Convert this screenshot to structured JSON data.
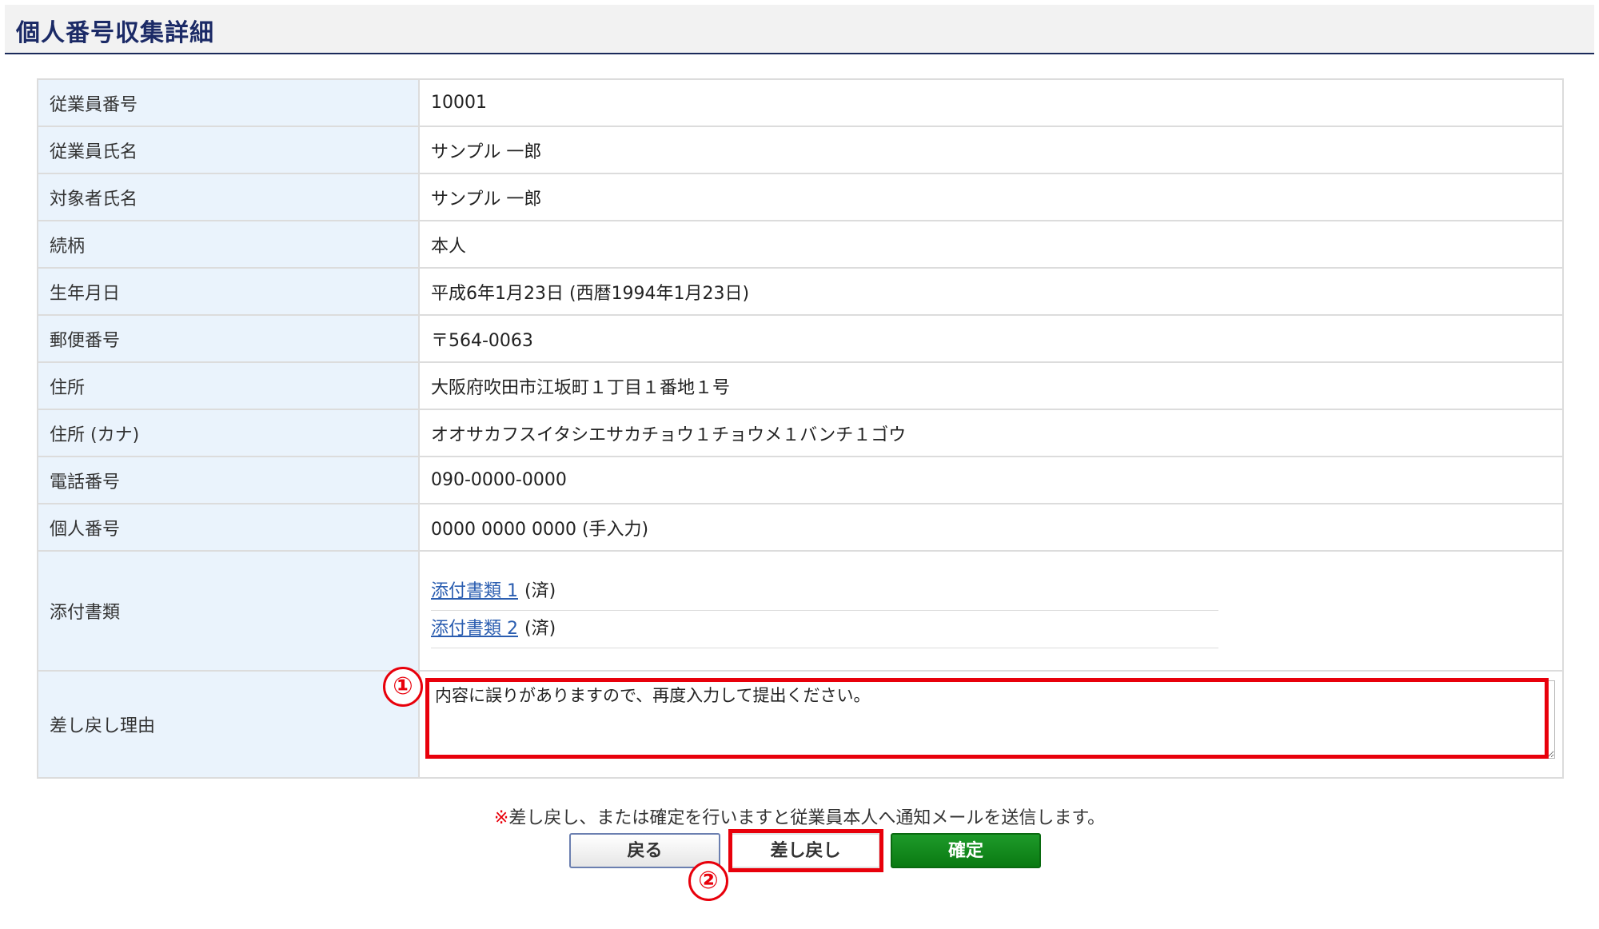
{
  "header": {
    "title": "個人番号収集詳細"
  },
  "details": {
    "rows": [
      {
        "label": "従業員番号",
        "value": "10001"
      },
      {
        "label": "従業員氏名",
        "value": "サンプル 一郎"
      },
      {
        "label": "対象者氏名",
        "value": "サンプル 一郎"
      },
      {
        "label": "続柄",
        "value": "本人"
      },
      {
        "label": "生年月日",
        "value": "平成6年1月23日 (西暦1994年1月23日)"
      },
      {
        "label": "郵便番号",
        "value": "〒564-0063"
      },
      {
        "label": "住所",
        "value": "大阪府吹田市江坂町１丁目１番地１号"
      },
      {
        "label": "住所 (カナ)",
        "value": "オオサカフスイタシエサカチョウ１チョウメ１バンチ１ゴウ"
      },
      {
        "label": "電話番号",
        "value": "090-0000-0000"
      },
      {
        "label": "個人番号",
        "value": "0000 0000 0000 (手入力)"
      }
    ],
    "attachments": {
      "label": "添付書類",
      "items": [
        {
          "link": "添付書類 1",
          "status": "(済)"
        },
        {
          "link": "添付書類 2",
          "status": "(済)"
        }
      ]
    },
    "return_reason": {
      "label": "差し戻し理由",
      "value": "内容に誤りがありますので、再度入力して提出ください。"
    }
  },
  "annotations": {
    "marker_1": "①",
    "marker_2": "②",
    "highlight_color": "#e8000b"
  },
  "notice": {
    "mark": "※",
    "text": "差し戻し、または確定を行いますと従業員本人へ通知メールを送信します。"
  },
  "buttons": {
    "back": "戻る",
    "return": "差し戻し",
    "confirm": "確定"
  },
  "colors": {
    "label_bg": "#eaf3fc",
    "title_color": "#1b2a66",
    "confirm_green": "#0a7a12",
    "link_blue": "#2a5db0"
  }
}
